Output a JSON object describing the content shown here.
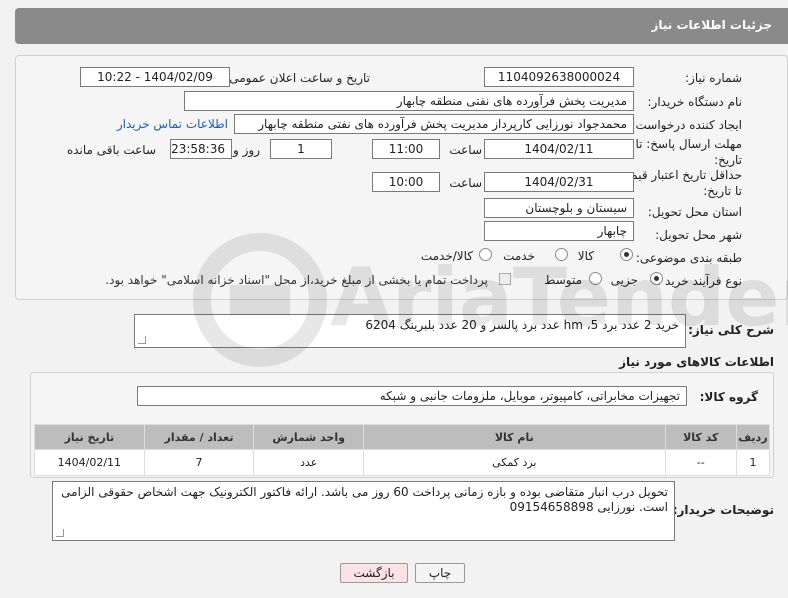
{
  "header": {
    "title": "جزئیات اطلاعات نیاز"
  },
  "form": {
    "need_number": {
      "label": "شماره نیاز:",
      "value": "1104092638000024"
    },
    "announce_datetime": {
      "label": "تاریخ و ساعت اعلان عمومی:",
      "value": "1404/02/09 - 10:22"
    },
    "buyer_org": {
      "label": "نام دستگاه خریدار:",
      "value": "مدیریت پخش فرآورده های نفتی منطقه چابهار"
    },
    "requester": {
      "label": "ایجاد کننده درخواست:",
      "value": "محمدجواد نورزایی کارپرداز مدیریت پخش فرآورده های نفتی منطقه چابهار",
      "link": "اطلاعات تماس خریدار"
    },
    "reply_deadline": {
      "label_line1": "مهلت ارسال پاسخ: تا",
      "label_line2": "تاریخ:",
      "date": "1404/02/11",
      "time_label": "ساعت",
      "time": "11:00",
      "days": "1",
      "days_label": "روز و",
      "remaining": "23:58:36",
      "remaining_label": "ساعت باقی مانده"
    },
    "price_validity": {
      "label_line1": "حداقل تاریخ اعتبار قیمت:",
      "label_line2": "تا تاریخ:",
      "date": "1404/02/31",
      "time_label": "ساعت",
      "time": "10:00"
    },
    "province": {
      "label": "استان محل تحویل:",
      "value": "سیستان و بلوچستان"
    },
    "city": {
      "label": "شهر محل تحویل:",
      "value": "چابهار"
    },
    "category": {
      "label": "طبقه بندی موضوعی:",
      "options": [
        "کالا",
        "خدمت",
        "کالا/خدمت"
      ],
      "selected": "کالا"
    },
    "purchase_type": {
      "label": "نوع فرآیند خرید :",
      "options": [
        "جزیی",
        "متوسط"
      ],
      "selected": "جزیی",
      "note": "پرداخت تمام یا بخشی از مبلغ خرید،از محل \"اسناد خزانه اسلامی\" خواهد بود."
    }
  },
  "summary": {
    "label": "شرح کلی نیاز:",
    "value": "خرید 2 عدد  برد 5، hm عدد برد پالسر و 20 عدد بلبرینگ 6204"
  },
  "goods": {
    "section_title": "اطلاعات کالاهای مورد نیاز",
    "group_label": "گروه کالا:",
    "group_value": "تجهیزات مخابراتی، کامپیوتر، موبایل، ملزومات جانبی و شبکه",
    "columns": [
      "ردیف",
      "کد کالا",
      "نام کالا",
      "واحد شمارش",
      "تعداد / مقدار",
      "تاریخ نیاز"
    ],
    "rows": [
      {
        "row": "1",
        "code": "--",
        "name": "برد کمکی",
        "unit": "عدد",
        "qty": "7",
        "date": "1404/02/11"
      }
    ]
  },
  "buyer_notes": {
    "label": "توضیحات خریدار:",
    "value": "تحویل درب انبار متقاضی بوده و بازه زمانی پرداخت 60 روز می باشد. ارائه فاکتور الکترونیک جهت اشخاص حقوقی الزامی است. نورزایی 09154658898"
  },
  "buttons": {
    "print": "چاپ",
    "back": "بازگشت"
  },
  "watermark": "AriaTender.neT",
  "colors": {
    "header_bg": "#8a8a8a",
    "table_header_bg": "#bdbdbd",
    "link": "#1a5fb4",
    "back_button_bg": "#fbe3e3"
  }
}
